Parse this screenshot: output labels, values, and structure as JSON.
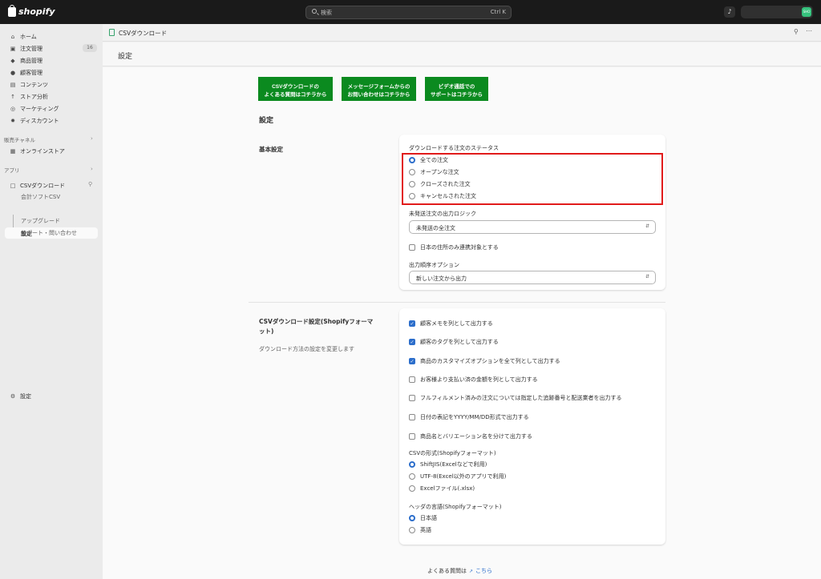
{
  "topbar": {
    "brand": "shopify",
    "search_placeholder": "検索",
    "search_shortcut": "Ctrl K",
    "avatar_text": "SHO"
  },
  "sidebar": {
    "items": [
      {
        "label": "ホーム",
        "icon": "home-icon"
      },
      {
        "label": "注文管理",
        "icon": "orders-icon"
      },
      {
        "label": "商品管理",
        "icon": "tag-icon"
      },
      {
        "label": "顧客管理",
        "icon": "person-icon"
      },
      {
        "label": "コンテンツ",
        "icon": "content-icon"
      },
      {
        "label": "ストア分析",
        "icon": "analytics-icon"
      },
      {
        "label": "マーケティング",
        "icon": "marketing-icon"
      },
      {
        "label": "ディスカウント",
        "icon": "discount-icon"
      }
    ],
    "orders_badge": "16",
    "sales_channels_label": "販売チャネル",
    "online_store": "オンラインストア",
    "apps_label": "アプリ",
    "app_name": "CSVダウンロード",
    "app_subitems": [
      "会計ソフトCSV",
      "設定",
      "アップグレード",
      "サポート・問い合わせ"
    ],
    "settings": "設定"
  },
  "app_header": {
    "title": "CSVダウンロード"
  },
  "page": {
    "title": "設定",
    "buttons": [
      {
        "line1": "CSVダウンロードの",
        "line2": "よくある質問はコチラから"
      },
      {
        "line1": "メッセージフォームからの",
        "line2": "お問い合わせはコチラから"
      },
      {
        "line1": "ビデオ通話での",
        "line2": "サポートはコチラから"
      }
    ],
    "settings_heading": "設定"
  },
  "basic": {
    "section_title": "基本設定",
    "status_label": "ダウンロードする注文のステータス",
    "status_options": [
      "全ての注文",
      "オープンな注文",
      "クローズされた注文",
      "キャンセルされた注文"
    ],
    "status_selected": 0,
    "unshipped_label": "未発送注文の出力ロジック",
    "unshipped_value": "未発送の全注文",
    "domestic_only": "日本の住所のみ連携対象とする",
    "order_label": "出力順序オプション",
    "order_value": "新しい注文から出力"
  },
  "csv": {
    "section_title_line1": "CSVダウンロード設定(Shopifyフォーマ",
    "section_title_line2": "ット)",
    "section_desc": "ダウンロード方法の設定を変更します",
    "checkboxes": [
      {
        "label": "顧客メモを列として出力する",
        "checked": true
      },
      {
        "label": "顧客のタグを列として出力する",
        "checked": true
      },
      {
        "label": "商品のカスタマイズオプションを全て列として出力する",
        "checked": true
      },
      {
        "label": "お客様より支払い済の金額を列として出力する",
        "checked": false
      },
      {
        "label": "フルフィルメント済みの注文については指定した追跡番号と配送業者を出力する",
        "checked": false
      },
      {
        "label": "日付の表記をYYYY/MM/DD形式で出力する",
        "checked": false
      },
      {
        "label": "商品名とバリエーション名を分けて出力する",
        "checked": false
      }
    ],
    "format_label": "CSVの形式(Shopifyフォーマット)",
    "format_options": [
      "ShiftJIS(Excelなどで利用)",
      "UTF-8(Excel以外のアプリで利用)",
      "Excelファイル(.xlsx)"
    ],
    "format_selected": 0,
    "header_lang_label": "ヘッダの言語(Shopifyフォーマット)",
    "header_lang_options": [
      "日本語",
      "英語"
    ],
    "header_lang_selected": 0
  },
  "footer": {
    "text": "よくある質問は",
    "link": "こちら"
  },
  "colors": {
    "green_button": "#0b8a1f",
    "accent_blue": "#2c6ecb",
    "highlight_red": "#e11b1b"
  }
}
